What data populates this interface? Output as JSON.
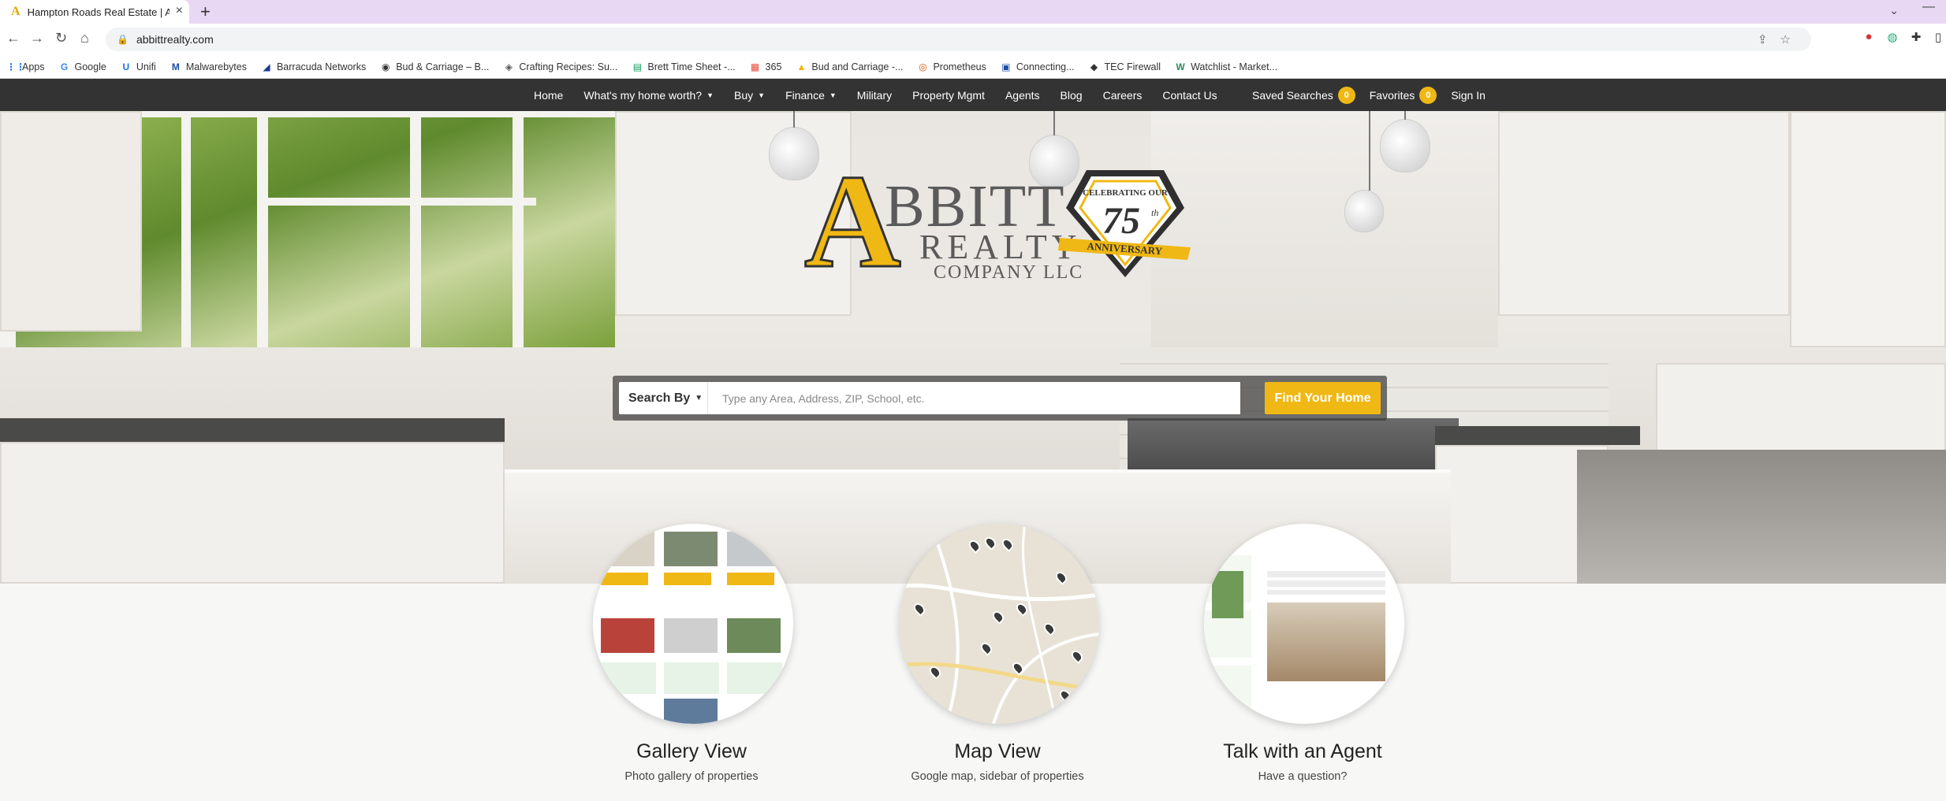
{
  "browser": {
    "tab_title": "Hampton Roads Real Estate | Abbitt",
    "url": "abbittrealty.com",
    "bookmarks": [
      {
        "label": "Apps",
        "icon": "apps-grid-icon"
      },
      {
        "label": "Google",
        "icon": "google-icon"
      },
      {
        "label": "Unifi",
        "icon": "unifi-icon"
      },
      {
        "label": "Malwarebytes",
        "icon": "malwarebytes-icon"
      },
      {
        "label": "Barracuda Networks",
        "icon": "barracuda-icon"
      },
      {
        "label": "Bud & Carriage – B...",
        "icon": "globe-icon"
      },
      {
        "label": "Crafting Recipes: Su...",
        "icon": "crafting-icon"
      },
      {
        "label": "Brett Time Sheet -...",
        "icon": "sheet-icon"
      },
      {
        "label": "365",
        "icon": "microsoft-icon"
      },
      {
        "label": "Bud and Carriage -...",
        "icon": "drive-icon"
      },
      {
        "label": "Prometheus",
        "icon": "prometheus-icon"
      },
      {
        "label": "Connecting...",
        "icon": "connect-icon"
      },
      {
        "label": "TEC Firewall",
        "icon": "firewall-icon"
      },
      {
        "label": "Watchlist - Market...",
        "icon": "watchlist-icon"
      }
    ]
  },
  "nav": {
    "links": [
      {
        "label": "Home",
        "dropdown": false
      },
      {
        "label": "What's my home worth?",
        "dropdown": true
      },
      {
        "label": "Buy",
        "dropdown": true
      },
      {
        "label": "Finance",
        "dropdown": true
      },
      {
        "label": "Military",
        "dropdown": false
      },
      {
        "label": "Property Mgmt",
        "dropdown": false
      },
      {
        "label": "Agents",
        "dropdown": false
      },
      {
        "label": "Blog",
        "dropdown": false
      },
      {
        "label": "Careers",
        "dropdown": false
      },
      {
        "label": "Contact Us",
        "dropdown": false
      }
    ],
    "saved_searches": {
      "label": "Saved Searches",
      "count": "0"
    },
    "favorites": {
      "label": "Favorites",
      "count": "0"
    },
    "sign_in": "Sign In"
  },
  "logo": {
    "letter": "A",
    "name": "BBITT",
    "line2": "REALTY",
    "line3": "COMPANY LLC",
    "seal_top": "CELEBRATING OUR",
    "seal_number": "75",
    "seal_suffix": "th",
    "seal_banner": "ANNIVERSARY"
  },
  "search": {
    "search_by_label": "Search By",
    "placeholder": "Type any Area, Address, ZIP, School, etc.",
    "button_label": "Find Your Home"
  },
  "features": [
    {
      "title": "Gallery View",
      "subtitle": "Photo gallery of properties"
    },
    {
      "title": "Map View",
      "subtitle": "Google map, sidebar of properties"
    },
    {
      "title": "Talk with an Agent",
      "subtitle": "Have a question?"
    }
  ],
  "colors": {
    "accent": "#f0b814",
    "navbar": "#333333",
    "tabstrip": "#e9d8f3"
  }
}
